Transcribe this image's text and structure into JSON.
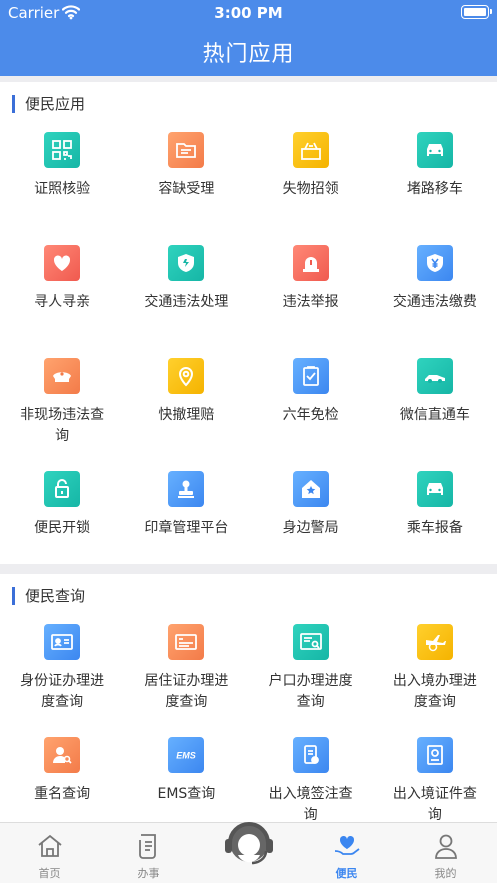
{
  "status_bar": {
    "carrier": "Carrier",
    "time": "3:00 PM"
  },
  "nav": {
    "title": "热门应用"
  },
  "section1": {
    "title": "便民应用",
    "items": [
      {
        "label": "证照核验",
        "icon": "qr-scan-icon",
        "color": "teal"
      },
      {
        "label": "容缺受理",
        "icon": "folder-icon",
        "color": "orange"
      },
      {
        "label": "失物招领",
        "icon": "lost-found-box-icon",
        "color": "yellow"
      },
      {
        "label": "堵路移车",
        "icon": "car-icon",
        "color": "teal"
      },
      {
        "label": "寻人寻亲",
        "icon": "heart-people-icon",
        "color": "red"
      },
      {
        "label": "交通违法处理",
        "icon": "traffic-shield-icon",
        "color": "teal"
      },
      {
        "label": "违法举报",
        "icon": "alarm-light-icon",
        "color": "red"
      },
      {
        "label": "交通违法缴费",
        "icon": "yuan-shield-icon",
        "color": "blue"
      },
      {
        "label": "非现场违法查询",
        "icon": "police-cap-icon",
        "color": "orange"
      },
      {
        "label": "快撤理赔",
        "icon": "location-pin-icon",
        "color": "yellow"
      },
      {
        "label": "六年免检",
        "icon": "clipboard-check-icon",
        "color": "blue"
      },
      {
        "label": "微信直通车",
        "icon": "sports-car-icon",
        "color": "teal"
      },
      {
        "label": "便民开锁",
        "icon": "lock-key-icon",
        "color": "teal"
      },
      {
        "label": "印章管理平台",
        "icon": "stamp-icon",
        "color": "blue"
      },
      {
        "label": "身边警局",
        "icon": "police-star-house-icon",
        "color": "blue"
      },
      {
        "label": "乘车报备",
        "icon": "car-icon",
        "color": "teal"
      }
    ]
  },
  "section2": {
    "title": "便民查询",
    "items": [
      {
        "label": "身份证办理进度查询",
        "icon": "id-card-icon",
        "color": "blue"
      },
      {
        "label": "居住证办理进度查询",
        "icon": "residence-card-icon",
        "color": "orange"
      },
      {
        "label": "户口办理进度查询",
        "icon": "household-register-icon",
        "color": "teal"
      },
      {
        "label": "出入境办理进度查询",
        "icon": "airplane-globe-icon",
        "color": "yellow"
      },
      {
        "label": "重名查询",
        "icon": "person-search-icon",
        "color": "orange"
      },
      {
        "label": "EMS查询",
        "icon": "ems-icon",
        "color": "blue"
      },
      {
        "label": "出入境签注查询",
        "icon": "visa-phone-icon",
        "color": "blue"
      },
      {
        "label": "出入境证件查询",
        "icon": "passport-icon",
        "color": "blue"
      }
    ]
  },
  "icon_text": {
    "ems": "EMS"
  },
  "tabbar": {
    "items": [
      {
        "label": "首页",
        "icon": "home-icon",
        "active": false
      },
      {
        "label": "办事",
        "icon": "document-icon",
        "active": false
      },
      {
        "label": "",
        "icon": "customer-service-icon",
        "active": false
      },
      {
        "label": "便民",
        "icon": "heart-hand-icon",
        "active": true
      },
      {
        "label": "我的",
        "icon": "person-icon",
        "active": false
      }
    ]
  },
  "colors": {
    "primary": "#4c8bea",
    "accent": "#3b86f0",
    "section_bar": "#3b6fd8"
  }
}
